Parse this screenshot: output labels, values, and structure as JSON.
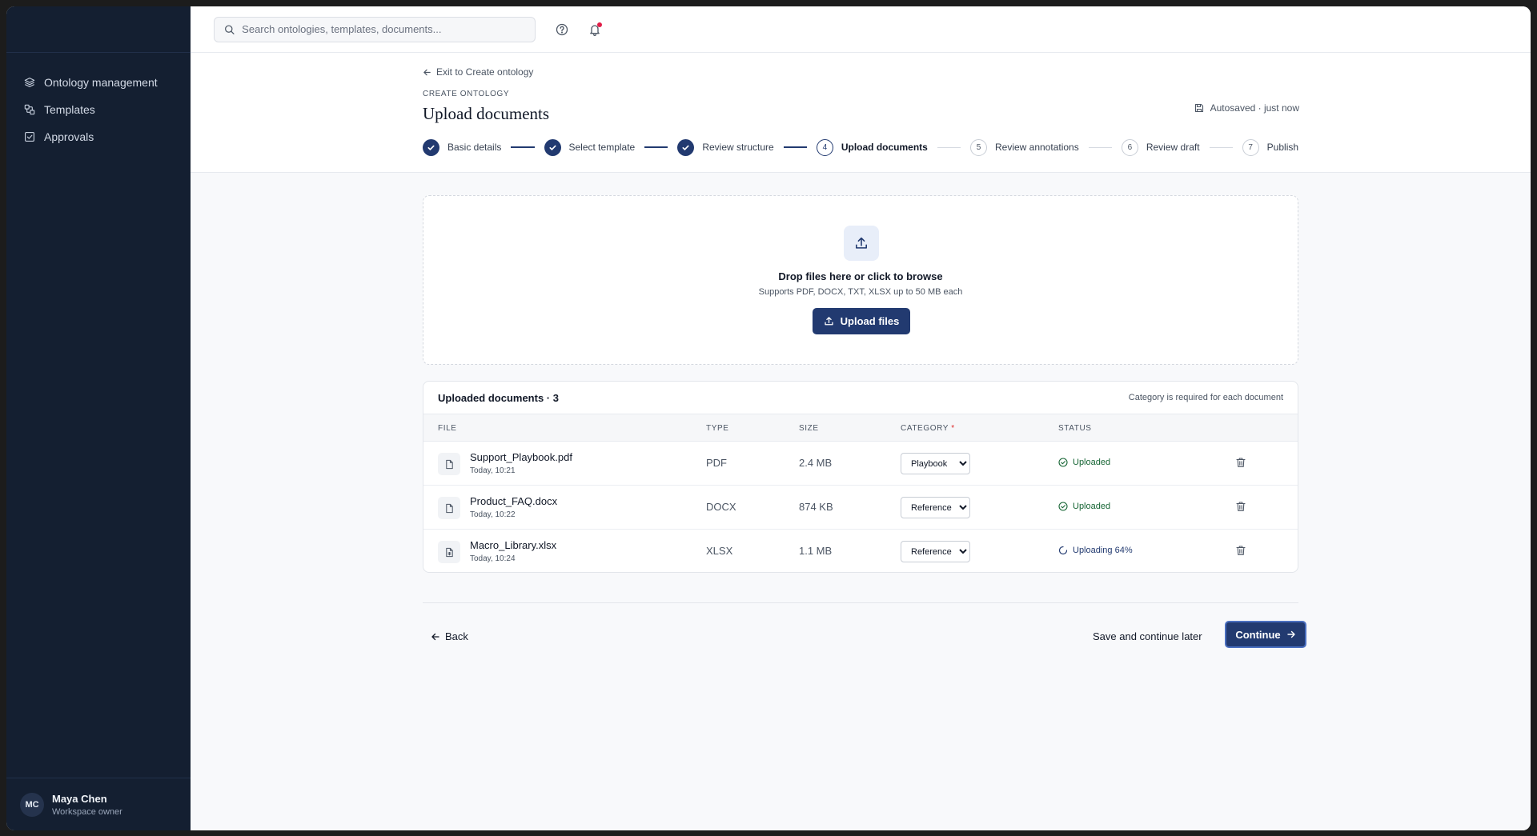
{
  "sidebar": {
    "items": [
      {
        "label": "Ontology management",
        "icon": "layers-icon"
      },
      {
        "label": "Templates",
        "icon": "templates-icon"
      },
      {
        "label": "Approvals",
        "icon": "check-square-icon"
      }
    ],
    "user": {
      "initials": "MC",
      "name": "Maya Chen",
      "role": "Workspace owner"
    }
  },
  "topbar": {
    "search_placeholder": "Search ontologies, templates, documents...",
    "notification_dot_color": "#e11d48"
  },
  "header": {
    "exit_link": "Exit to Create ontology",
    "eyebrow": "CREATE ONTOLOGY",
    "title": "Upload documents",
    "autosave": "Autosaved · just now"
  },
  "steps": [
    {
      "label": "Basic details",
      "number": "1",
      "state": "done"
    },
    {
      "label": "Select template",
      "number": "2",
      "state": "done"
    },
    {
      "label": "Review structure",
      "number": "3",
      "state": "done"
    },
    {
      "label": "Upload documents",
      "number": "4",
      "state": "current"
    },
    {
      "label": "Review annotations",
      "number": "5",
      "state": "todo"
    },
    {
      "label": "Review draft",
      "number": "6",
      "state": "todo"
    },
    {
      "label": "Publish",
      "number": "7",
      "state": "todo"
    }
  ],
  "dropzone": {
    "title": "Drop files here or click to browse",
    "subtitle": "Supports PDF, DOCX, TXT, XLSX up to 50 MB each",
    "button": "Upload files"
  },
  "documents": {
    "title": "Uploaded documents · 3",
    "note": "Category is required for each document",
    "columns": {
      "file": "FILE",
      "type": "TYPE",
      "size": "SIZE",
      "category": "CATEGORY",
      "required_mark": "*",
      "status": "STATUS"
    },
    "rows": [
      {
        "name": "Support_Playbook.pdf",
        "date": "Today, 10:21",
        "type": "PDF",
        "size": "2.4 MB",
        "category": "Playbook",
        "status": "Uploaded",
        "state": "uploaded"
      },
      {
        "name": "Product_FAQ.docx",
        "date": "Today, 10:22",
        "type": "DOCX",
        "size": "874 KB",
        "category": "Reference",
        "status": "Uploaded",
        "state": "uploaded"
      },
      {
        "name": "Macro_Library.xlsx",
        "date": "Today, 10:24",
        "type": "XLSX",
        "size": "1.1 MB",
        "category": "Reference",
        "status": "Uploading 64%",
        "state": "uploading",
        "progress_percent": 64
      }
    ],
    "category_options": [
      "Playbook",
      "Reference"
    ]
  },
  "footer": {
    "back": "Back",
    "save_later": "Save and continue later",
    "continue": "Continue"
  },
  "colors": {
    "accent": "#223a70",
    "sidebar_bg": "#141f31",
    "success": "#166534"
  }
}
